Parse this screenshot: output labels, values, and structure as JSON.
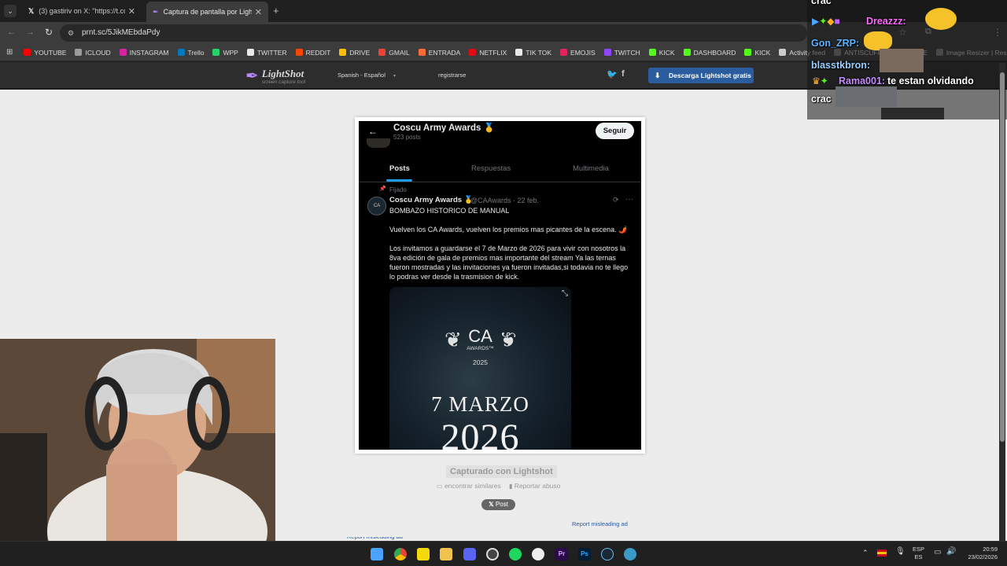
{
  "browser": {
    "tabs": [
      {
        "title": "(3) gastiriv on X: \"https://t.co/1l",
        "active": false
      },
      {
        "title": "Captura de pantalla por Lightsh",
        "active": true
      }
    ],
    "new_tab": "+",
    "url": "prnt.sc/5JikMEbdaPdy",
    "bookmarks": [
      {
        "label": "YOUTUBE",
        "color": "#ff0000"
      },
      {
        "label": "ICLOUD",
        "color": "#9b9b9b"
      },
      {
        "label": "INSTAGRAM",
        "color": "#d6249f"
      },
      {
        "label": "Trello",
        "color": "#0079bf"
      },
      {
        "label": "WPP",
        "color": "#25d366"
      },
      {
        "label": "TWITTER",
        "color": "#e7e9ea"
      },
      {
        "label": "REDDIT",
        "color": "#ff4500"
      },
      {
        "label": "DRIVE",
        "color": "#fbbc04"
      },
      {
        "label": "GMAIL",
        "color": "#ea4335"
      },
      {
        "label": "ENTRADA",
        "color": "#ff6b35"
      },
      {
        "label": "NETFLIX",
        "color": "#e50914"
      },
      {
        "label": "TIK TOK",
        "color": "#e7e9ea"
      },
      {
        "label": "EMOJIS",
        "color": "#e0245e"
      },
      {
        "label": "TWITCH",
        "color": "#9146ff"
      },
      {
        "label": "KICK",
        "color": "#53fc18"
      },
      {
        "label": "DASHBOARD",
        "color": "#53fc18"
      },
      {
        "label": "KICK",
        "color": "#53fc18"
      },
      {
        "label": "Activity feed",
        "color": "#cccccc"
      },
      {
        "label": "ANTISCUFF",
        "color": "#888888"
      },
      {
        "label": "FUENTE",
        "color": "#888888"
      },
      {
        "label": "Image Resizer | Resi...",
        "color": "#888888"
      }
    ]
  },
  "lightshot": {
    "logo": "LightShot",
    "tagline": "screen capture tool",
    "language": "Spanish - Español",
    "register": "registrarse",
    "download": "Descarga Lightshot gratis",
    "captured_with": "Capturado con Lightshot",
    "find_similar": "encontrar similares",
    "report_abuse": "Reportar abuso",
    "post_button": "Post",
    "report_ad": "Report misleading ad",
    "report_ad2": "Report misleading ad"
  },
  "screenshot": {
    "profile_name": "Coscu Army Awards 🥇",
    "post_count": "523 posts",
    "follow": "Seguir",
    "tabs": [
      "Posts",
      "Respuestas",
      "Multimedia"
    ],
    "pinned": "Fijado",
    "author": "Coscu Army Awards 🥇",
    "handle": "@CAAwards · 22 feb.",
    "line1": "BOMBAZO HISTORICO DE MANUAL",
    "line2": "Vuelven los CA Awards, vuelven los premios mas picantes de la escena. 🌶️",
    "line3": "Los invitamos a guardarse el 7 de Marzo de 2026 para vivir con nosotros la 8va edición de gala de premios mas importante del stream      Ya las ternas fueron mostradas y las invitaciones ya fueron invitadas,si todavia no te llego lo podras ver desde la trasmision de kick.",
    "poster_logo": "CA",
    "poster_sub": "AWARDS™",
    "poster_year": "2025",
    "poster_date": "7 MARZO",
    "poster_big_year": "2026"
  },
  "chat": [
    {
      "user": "crac",
      "msg": "",
      "color": "#ffffff"
    },
    {
      "user": "Dreazzz:",
      "msg": "",
      "color": "#ff6bff"
    },
    {
      "user": "Gon_ZRP:",
      "msg": "",
      "color": "#5ab4ff"
    },
    {
      "user": "blasstkbron:",
      "msg": "",
      "color": "#9ad0ff"
    },
    {
      "user": "Rama001:",
      "msg": "te estan olvidando",
      "color": "#c58cff"
    },
    {
      "user": "crac",
      "msg": "",
      "color": "#ffffff"
    }
  ],
  "taskbar": {
    "lang": "ESP",
    "lang2": "ES",
    "time": "20:59",
    "date": "23/02/2026",
    "apps": [
      "windows",
      "chrome",
      "sticky",
      "folder",
      "discord",
      "obs",
      "spotify",
      "github",
      "premiere",
      "photoshop",
      "steam",
      "edge"
    ]
  }
}
